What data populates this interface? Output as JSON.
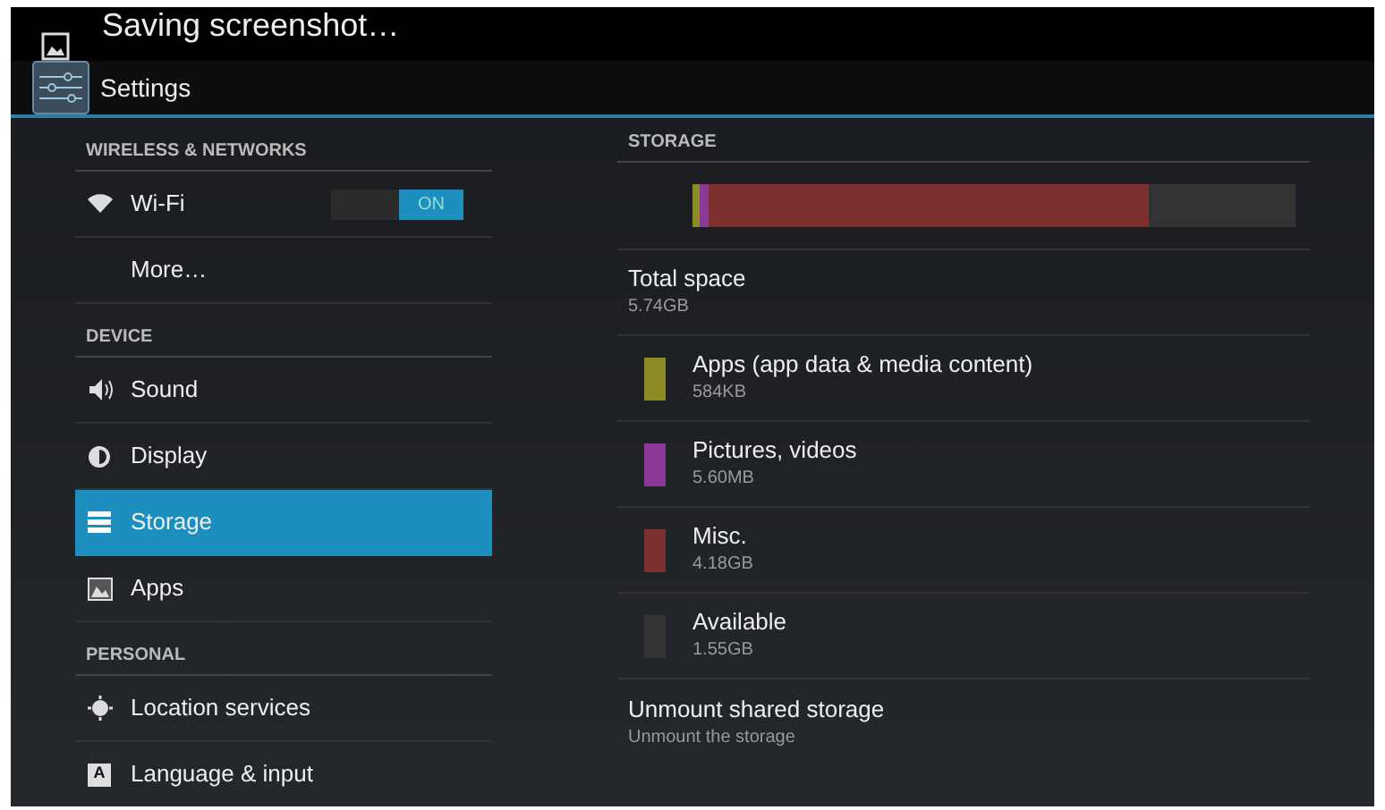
{
  "notification": {
    "text": "Saving screenshot…"
  },
  "action_bar": {
    "title": "Settings"
  },
  "sidebar": {
    "items": [
      {
        "kind": "header",
        "label": "WIRELESS & NETWORKS"
      },
      {
        "kind": "item",
        "label": "Wi-Fi",
        "selected": false,
        "toggle": {
          "on": true,
          "label": "ON"
        }
      },
      {
        "kind": "item",
        "label": "More…",
        "selected": false
      },
      {
        "kind": "header",
        "label": "DEVICE"
      },
      {
        "kind": "item",
        "label": "Sound",
        "selected": false
      },
      {
        "kind": "item",
        "label": "Display",
        "selected": false
      },
      {
        "kind": "item",
        "label": "Storage",
        "selected": true
      },
      {
        "kind": "item",
        "label": "Apps",
        "selected": false
      },
      {
        "kind": "header",
        "label": "PERSONAL"
      },
      {
        "kind": "item",
        "label": "Location services",
        "selected": false
      },
      {
        "kind": "item",
        "icon_text": "A",
        "label": "Language & input",
        "selected": false
      }
    ]
  },
  "storage": {
    "header": "STORAGE",
    "total": {
      "label": "Total space",
      "value": "5.74GB"
    },
    "categories": [
      {
        "label": "Apps (app data & media content)",
        "value": "584KB",
        "color": "#8c8c24"
      },
      {
        "label": "Pictures, videos",
        "value": "5.60MB",
        "color": "#8a3a96"
      },
      {
        "label": "Misc.",
        "value": "4.18GB",
        "color": "#7e2f2f"
      },
      {
        "label": "Available",
        "value": "1.55GB",
        "color": "#333333"
      }
    ],
    "unmount": {
      "label": "Unmount shared storage",
      "summary": "Unmount the storage"
    }
  }
}
